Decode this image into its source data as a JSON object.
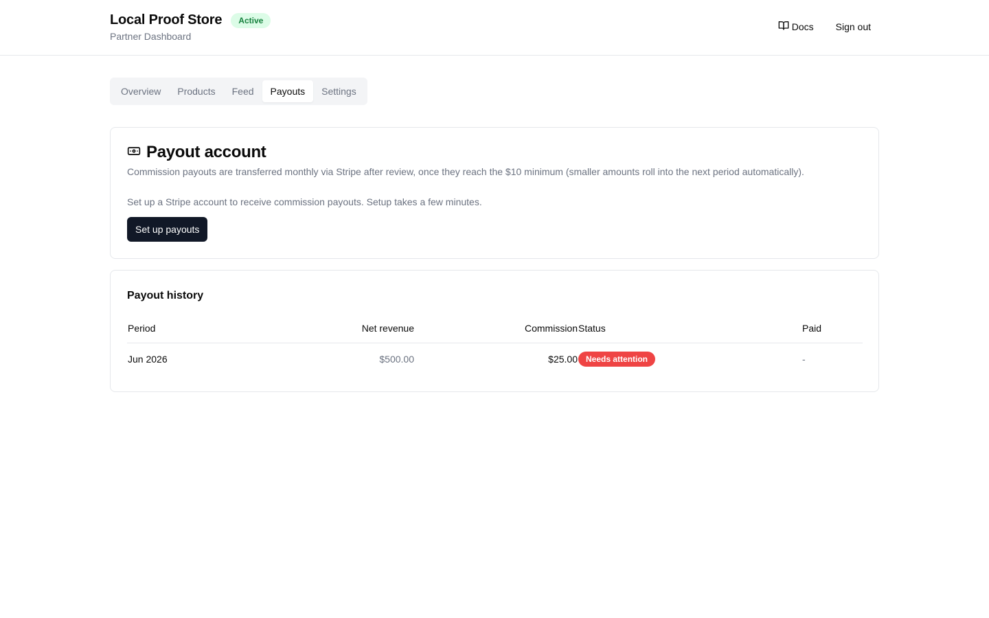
{
  "header": {
    "store_name": "Local Proof Store",
    "status": "Active",
    "subtitle": "Partner Dashboard",
    "docs_label": "Docs",
    "docs_icon": "book-open-icon",
    "signout_label": "Sign out"
  },
  "tabs": [
    {
      "label": "Overview",
      "active": false
    },
    {
      "label": "Products",
      "active": false
    },
    {
      "label": "Feed",
      "active": false
    },
    {
      "label": "Payouts",
      "active": true
    },
    {
      "label": "Settings",
      "active": false
    }
  ],
  "payout_account": {
    "icon": "banknote-icon",
    "title": "Payout account",
    "description": "Commission payouts are transferred monthly via Stripe after review, once they reach the $10 minimum (smaller amounts roll into the next period automatically).",
    "setup_text": "Set up a Stripe account to receive commission payouts. Setup takes a few minutes.",
    "setup_button": "Set up payouts"
  },
  "payout_history": {
    "title": "Payout history",
    "columns": {
      "period": "Period",
      "net_revenue": "Net revenue",
      "commission": "Commission",
      "status": "Status",
      "paid": "Paid"
    },
    "rows": [
      {
        "period": "Jun 2026",
        "net_revenue": "$500.00",
        "commission": "$25.00",
        "status": "Needs attention",
        "paid": "-"
      }
    ]
  },
  "colors": {
    "active_badge_bg": "#dcfce7",
    "active_badge_text": "#15803d",
    "attention_badge_bg": "#ef4444",
    "primary_button_bg": "#111827"
  }
}
